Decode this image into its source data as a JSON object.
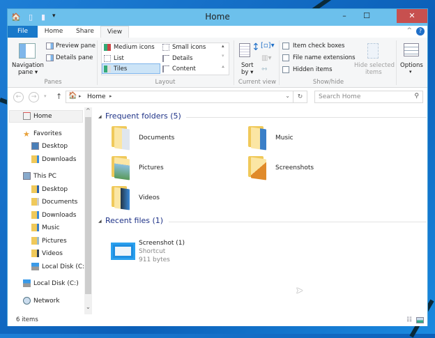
{
  "window": {
    "title": "Home"
  },
  "quick_access": {
    "icons": [
      "home-icon",
      "properties-icon",
      "new-folder-icon",
      "customize-dropdown-icon"
    ]
  },
  "window_controls": {
    "minimize": "–",
    "maximize": "☐",
    "close": "✕"
  },
  "tabs": [
    {
      "label": "File"
    },
    {
      "label": "Home"
    },
    {
      "label": "Share"
    },
    {
      "label": "View",
      "selected": true
    }
  ],
  "ribbon": {
    "panes": {
      "navigation_pane": "Navigation",
      "navigation_pane2": "pane ▾",
      "preview_pane": "Preview pane",
      "details_pane": "Details pane",
      "label": "Panes"
    },
    "layout": {
      "items": [
        "Medium icons",
        "List",
        "Tiles",
        "Small icons",
        "Details",
        "Content"
      ],
      "selected": "Tiles",
      "label": "Layout"
    },
    "current_view": {
      "sort_by": "Sort",
      "sort_by2": "by ▾",
      "label": "Current view"
    },
    "show_hide": {
      "item_check_boxes": "Item check boxes",
      "file_name_extensions": "File name extensions",
      "hidden_items": "Hidden items",
      "hide_selected": "Hide selected",
      "hide_selected2": "items",
      "label": "Show/hide"
    },
    "options": {
      "label": "Options",
      "arrow": "▾"
    }
  },
  "address": {
    "path": "Home",
    "search_placeholder": "Search Home"
  },
  "nav": {
    "home": "Home",
    "favorites": "Favorites",
    "favorites_items": [
      "Desktop",
      "Downloads"
    ],
    "this_pc": "This PC",
    "this_pc_items": [
      "Desktop",
      "Documents",
      "Downloads",
      "Music",
      "Pictures",
      "Videos",
      "Local Disk (C:)"
    ],
    "local_disk": "Local Disk (C:)",
    "network": "Network"
  },
  "content": {
    "frequent_title": "Frequent folders (5)",
    "frequent": [
      "Documents",
      "Music",
      "Pictures",
      "Screenshots",
      "Videos"
    ],
    "recent_title": "Recent files (1)",
    "recent": [
      {
        "name": "Screenshot (1)",
        "type": "Shortcut",
        "size": "911 bytes"
      }
    ]
  },
  "status": {
    "items": "6 items"
  },
  "colors": {
    "file_tab": "#1979ca",
    "titlebar": "#6cc0ec",
    "section_heading": "#1e3287",
    "close": "#c7504f"
  }
}
